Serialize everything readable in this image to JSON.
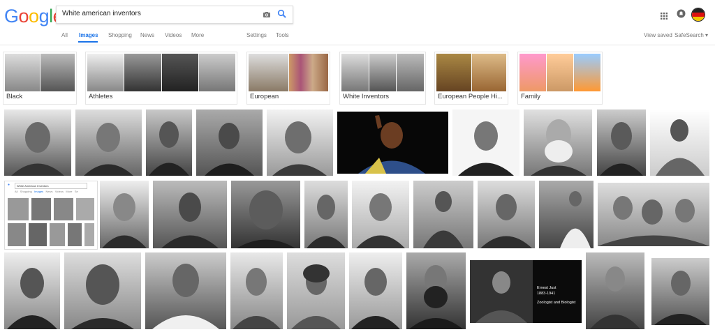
{
  "logo": {
    "letters": [
      "G",
      "o",
      "o",
      "g",
      "l",
      "e"
    ],
    "colors": [
      "#4285F4",
      "#EA4335",
      "#FBBC05",
      "#4285F4",
      "#34A853",
      "#EA4335"
    ]
  },
  "search": {
    "query": "White american inventors"
  },
  "tabs": {
    "all": "All",
    "images": "Images",
    "shopping": "Shopping",
    "news": "News",
    "videos": "Videos",
    "more": "More",
    "settings": "Settings",
    "tools": "Tools"
  },
  "right_links": {
    "view_saved": "View saved",
    "safesearch": "SafeSearch ▾"
  },
  "chips": [
    "Black",
    "Athletes",
    "European",
    "White Inventors",
    "European People Hi...",
    "Family"
  ],
  "mini_screenshot": {
    "query": "White American Inventors",
    "tabs": [
      "All",
      "Shopping",
      "Images",
      "News",
      "Videos",
      "More",
      "Se"
    ]
  },
  "ernest_card": {
    "name": "Ernest Just",
    "years": "1883-1941",
    "role": "Zoologist and Biologist"
  }
}
